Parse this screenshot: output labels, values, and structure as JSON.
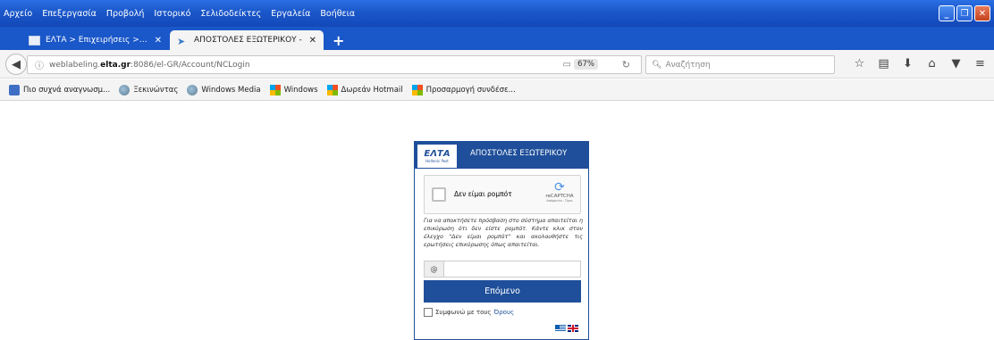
{
  "menu": [
    "Αρχείο",
    "Επεξεργασία",
    "Προβολή",
    "Ιστορικό",
    "Σελιδοδείκτες",
    "Εργαλεία",
    "Βοήθεια"
  ],
  "tabs": [
    {
      "label": "ΕΛΤΑ > Επιχειρήσεις > Αλληλ...",
      "active": false
    },
    {
      "label": "ΑΠΟΣΤΟΛΕΣ ΕΞΩΤΕΡΙΚΟΥ -",
      "active": true
    }
  ],
  "nav": {
    "url_prefix": "weblabeling.",
    "url_domain": "elta.gr",
    "url_rest": ":8086/el-GR/Account/NCLogin",
    "zoom": "67%",
    "search_placeholder": "Αναζήτηση"
  },
  "bookmarks": [
    {
      "label": "Πιο συχνά αναγνωσμ...",
      "icon": "search-icon"
    },
    {
      "label": "Ξεκινώντας",
      "icon": "globe-icon"
    },
    {
      "label": "Windows Media",
      "icon": "globe-icon"
    },
    {
      "label": "Windows",
      "icon": "windows-icon"
    },
    {
      "label": "Δωρεάν Hotmail",
      "icon": "windows-icon"
    },
    {
      "label": "Προσαρμογή συνδέσε...",
      "icon": "windows-icon"
    }
  ],
  "login": {
    "logo": "ΕΛΤΑ",
    "logo_sub": "Hellenic Post",
    "title": "ΑΠΟΣΤΟΛΕΣ ΕΞΩΤΕΡΙΚΟΥ",
    "captcha_label": "Δεν είμαι ρομπότ",
    "captcha_brand": "reCAPTCHA",
    "captcha_links": "Απόρρητο - Όροι",
    "info": "Για να αποκτήσετε πρόσβαση στο σύστημα απαιτείται η επικύρωση ότι δεν είστε ρομπότ. Κάντε κλικ στον έλεγχο \"Δεν είμαι ρομπότ\" και ακολουθήστε τις ερωτήσεις επικύρωσης όπως απαιτείται.",
    "email_addon": "@",
    "email_value": "",
    "next_label": "Επόμενο",
    "terms_text": "Συμφωνώ με τους",
    "terms_link": "Όρους"
  }
}
